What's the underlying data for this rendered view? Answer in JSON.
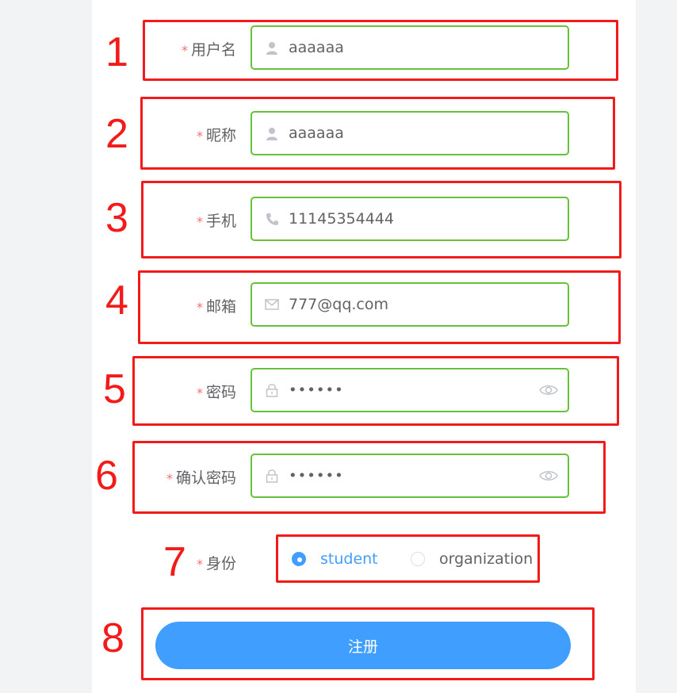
{
  "form": {
    "username": {
      "label": "用户名",
      "value": "aaaaaa",
      "icon": "user-icon"
    },
    "nickname": {
      "label": "昵称",
      "value": "aaaaaa",
      "icon": "user-icon"
    },
    "phone": {
      "label": "手机",
      "value": "11145354444",
      "icon": "phone-icon"
    },
    "email": {
      "label": "邮箱",
      "value": "777@qq.com",
      "icon": "mail-icon"
    },
    "password": {
      "label": "密码",
      "value": "••••••",
      "icon": "lock-icon",
      "suffix_icon": "eye-icon"
    },
    "confirm_password": {
      "label": "确认密码",
      "value": "••••••",
      "icon": "lock-icon",
      "suffix_icon": "eye-icon"
    },
    "identity": {
      "label": "身份",
      "options": [
        {
          "label": "student",
          "selected": true
        },
        {
          "label": "organization",
          "selected": false
        }
      ]
    },
    "required_mark": "*",
    "submit_label": "注册"
  },
  "annotations": [
    "1",
    "2",
    "3",
    "4",
    "5",
    "6",
    "7",
    "8"
  ],
  "colors": {
    "valid_border": "#67c23a",
    "primary": "#409eff",
    "required": "#f56c6c",
    "annotation": "#f31a1a"
  }
}
